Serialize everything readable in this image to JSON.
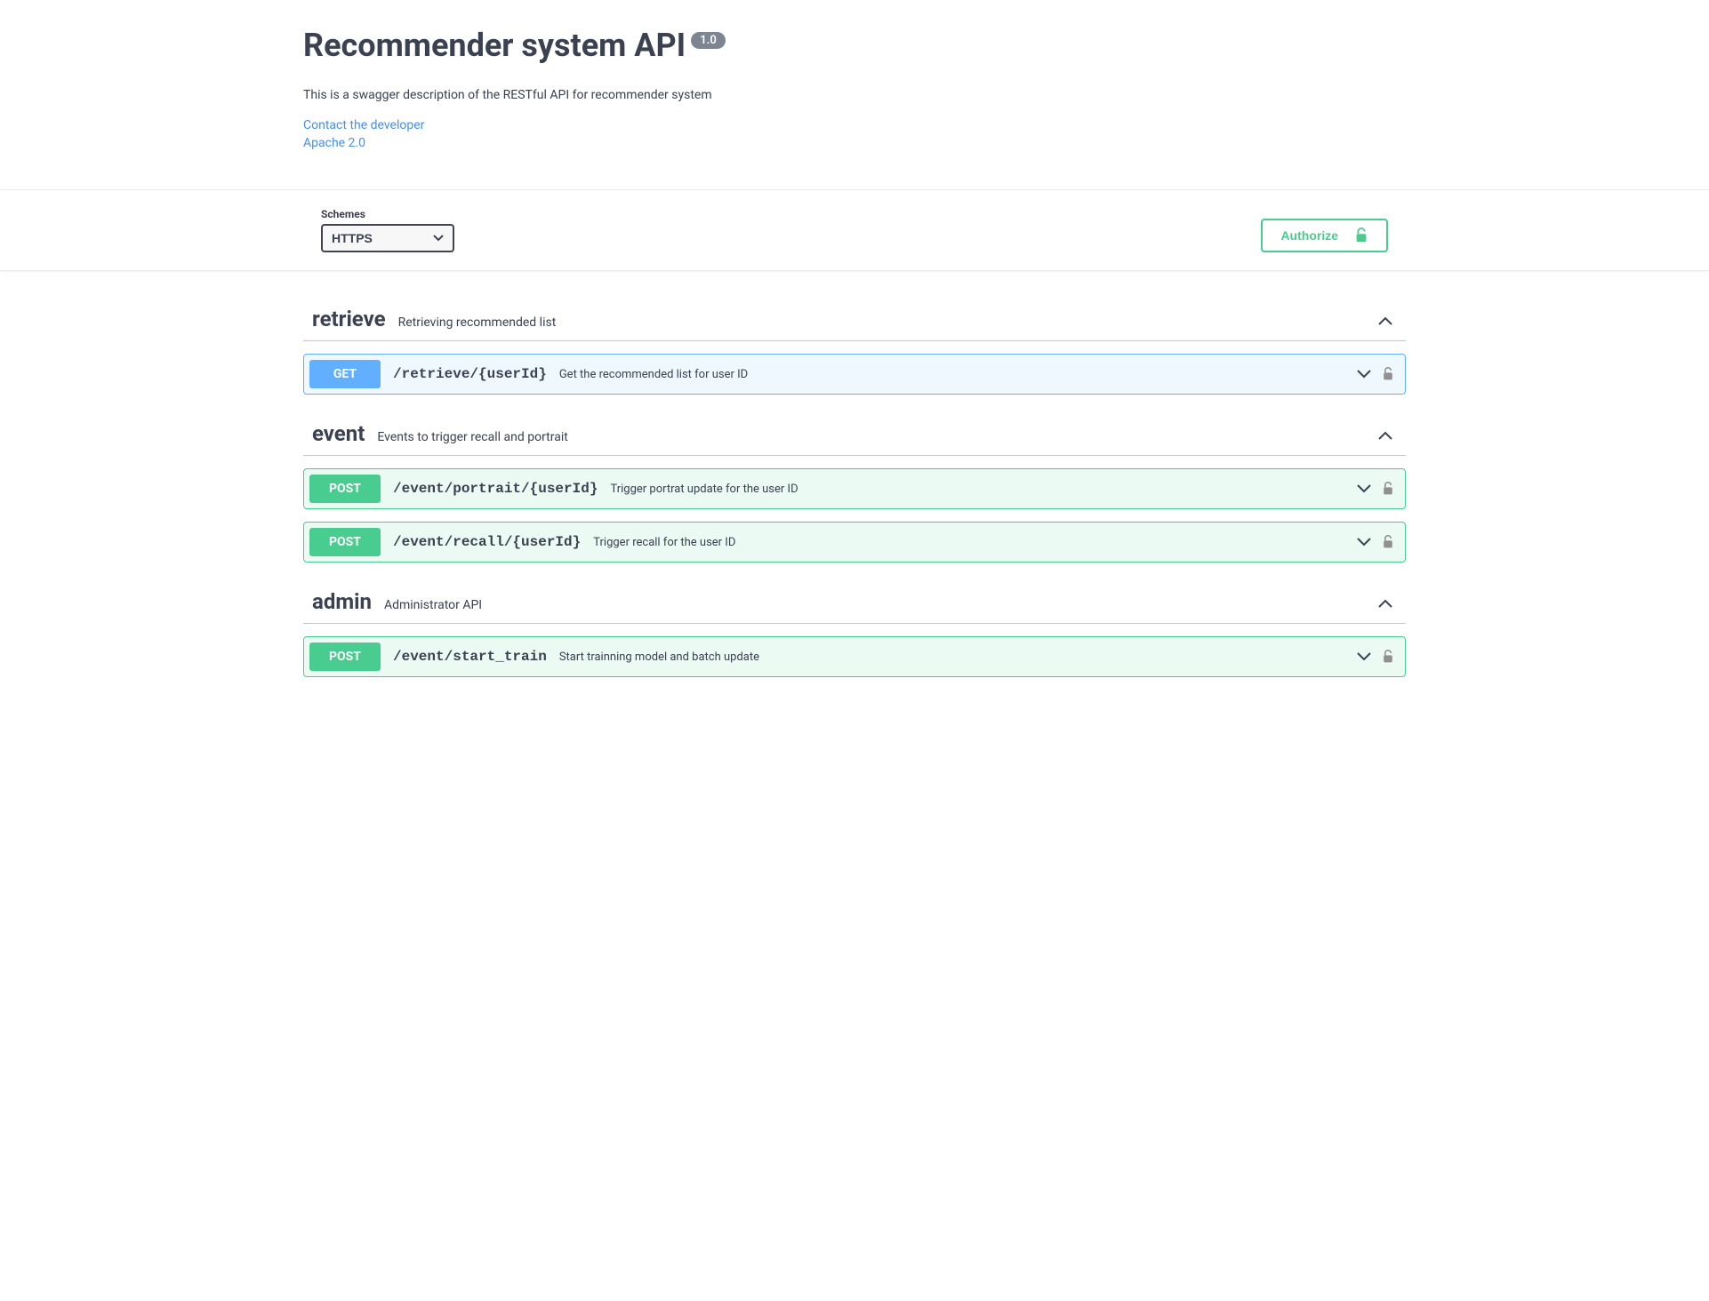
{
  "header": {
    "title": "Recommender system API",
    "version": "1.0",
    "description": "This is a swagger description of the RESTful API for recommender system",
    "contact_label": "Contact the developer",
    "license_label": "Apache 2.0"
  },
  "schemes": {
    "label": "Schemes",
    "selected": "HTTPS",
    "options": [
      "HTTPS"
    ]
  },
  "authorize": {
    "label": "Authorize"
  },
  "tags": [
    {
      "name": "retrieve",
      "description": "Retrieving recommended list",
      "expanded": true,
      "operations": [
        {
          "method": "GET",
          "path": "/retrieve/{userId}",
          "summary": "Get the recommended list for user ID"
        }
      ]
    },
    {
      "name": "event",
      "description": "Events to trigger recall and portrait",
      "expanded": true,
      "operations": [
        {
          "method": "POST",
          "path": "/event/portrait/{userId}",
          "summary": "Trigger portrat update for the user ID"
        },
        {
          "method": "POST",
          "path": "/event/recall/{userId}",
          "summary": "Trigger recall for the user ID"
        }
      ]
    },
    {
      "name": "admin",
      "description": "Administrator API",
      "expanded": true,
      "operations": [
        {
          "method": "POST",
          "path": "/event/start_train",
          "summary": "Start trainning model and batch update"
        }
      ]
    }
  ]
}
